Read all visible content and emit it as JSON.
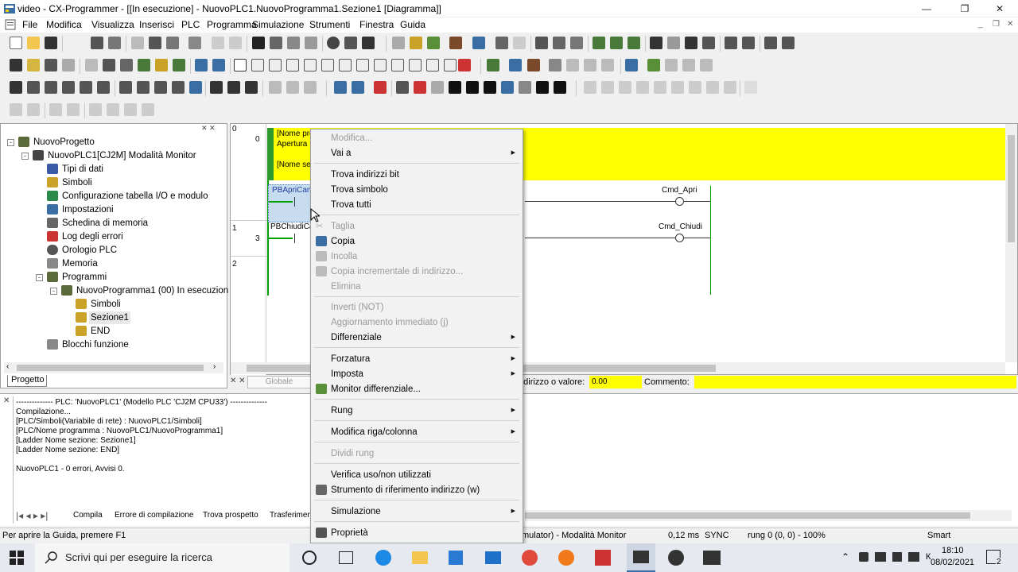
{
  "window": {
    "title": "video - CX-Programmer - [[In esecuzione] - NuovoPLC1.NuovoProgramma1.Sezione1 [Diagramma]]"
  },
  "menubar": [
    "File",
    "Modifica",
    "Visualizza",
    "Inserisci",
    "PLC",
    "Programma",
    "Simulazione",
    "Strumenti",
    "Finestra",
    "Guida"
  ],
  "project_tree": {
    "root": "NuovoProgetto",
    "plc": "NuovoPLC1[CJ2M] Modalità Monitor",
    "items": [
      "Tipi di dati",
      "Simboli",
      "Configurazione tabella I/O e modulo",
      "Impostazioni",
      "Schedina di memoria",
      "Log degli errori",
      "Orologio PLC",
      "Memoria",
      "Programmi"
    ],
    "program": "NuovoProgramma1 (00) In esecuzion",
    "program_items": [
      "Simboli",
      "Sezione1",
      "END"
    ],
    "function_blocks": "Blocchi funzione",
    "tab": "Progetto"
  },
  "ladder": {
    "rung_numbers": [
      "0",
      "1",
      "2"
    ],
    "step_numbers": [
      "0",
      "3"
    ],
    "comment_lines": [
      "[Nome pro",
      "Apertura",
      "[Nome se"
    ],
    "contact1": "PBApriCan",
    "contact2": "PBChiudiCa",
    "coil1": "Cmd_Apri",
    "coil2": "Cmd_Chiudi"
  },
  "addrbar": {
    "tab_globale": "Globale",
    "addr_label": "Indirizzo o valore:",
    "addr_value": "0.00",
    "comment_label": "Commento:"
  },
  "output": {
    "lines": [
      "-------------- PLC: 'NuovoPLC1' (Modello PLC 'CJ2M CPU33') --------------",
      "Compilazione...",
      "[PLC/Simboli(Variabile di rete) : NuovoPLC1/Simboli]",
      "[PLC/Nome programma : NuovoPLC1/NuovoProgramma1]",
      "[Ladder Nome sezione: Sezione1]",
      "[Ladder Nome sezione: END]",
      "",
      "NuovoPLC1 - 0 errori, Avvisi 0."
    ],
    "tabs": [
      "Compila",
      "Errore di compilazione",
      "Trova prospetto",
      "Trasferimen"
    ]
  },
  "statusbar": {
    "help": "Per aprire la Guida, premere F1",
    "mode": "mulator) - Modalità Monitor",
    "cycle": "0,12 ms",
    "sync": "SYNC",
    "rung": "rung 0 (0, 0)  - 100%",
    "view": "Smart"
  },
  "context_menu": {
    "items": [
      {
        "label": "Modifica...",
        "disabled": true,
        "submenu": false
      },
      {
        "label": "Vai a",
        "disabled": false,
        "submenu": true
      },
      {
        "label": "Trova indirizzi bit",
        "disabled": false,
        "submenu": false
      },
      {
        "label": "Trova simbolo",
        "disabled": false,
        "submenu": false
      },
      {
        "label": "Trova tutti",
        "disabled": false,
        "submenu": false
      },
      {
        "label": "Taglia",
        "disabled": true,
        "submenu": false
      },
      {
        "label": "Copia",
        "disabled": false,
        "submenu": false
      },
      {
        "label": "Incolla",
        "disabled": true,
        "submenu": false
      },
      {
        "label": "Copia incrementale di indirizzo...",
        "disabled": true,
        "submenu": false
      },
      {
        "label": "Elimina",
        "disabled": true,
        "submenu": false
      },
      {
        "label": "Inverti (NOT)",
        "disabled": true,
        "submenu": false
      },
      {
        "label": "Aggiornamento immediato (j)",
        "disabled": true,
        "submenu": false
      },
      {
        "label": "Differenziale",
        "disabled": false,
        "submenu": true
      },
      {
        "label": "Forzatura",
        "disabled": false,
        "submenu": true
      },
      {
        "label": "Imposta",
        "disabled": false,
        "submenu": true
      },
      {
        "label": "Monitor differenziale...",
        "disabled": false,
        "submenu": false
      },
      {
        "label": "Rung",
        "disabled": false,
        "submenu": true
      },
      {
        "label": "Modifica riga/colonna",
        "disabled": false,
        "submenu": true
      },
      {
        "label": "Dividi rung",
        "disabled": true,
        "submenu": false
      },
      {
        "label": "Verifica uso/non utilizzati",
        "disabled": false,
        "submenu": false
      },
      {
        "label": "Strumento di riferimento indirizzo (w)",
        "disabled": false,
        "submenu": false
      },
      {
        "label": "Simulazione",
        "disabled": false,
        "submenu": true
      },
      {
        "label": "Proprietà",
        "disabled": false,
        "submenu": false
      }
    ]
  },
  "taskbar": {
    "search_placeholder": "Scrivi qui per eseguire la ricerca",
    "time": "18:10",
    "date": "08/02/2021",
    "notifications": "2"
  },
  "colors": {
    "comment_bg": "#ffff00",
    "rung_green": "#00a000",
    "selection": "#c8dcf0"
  }
}
